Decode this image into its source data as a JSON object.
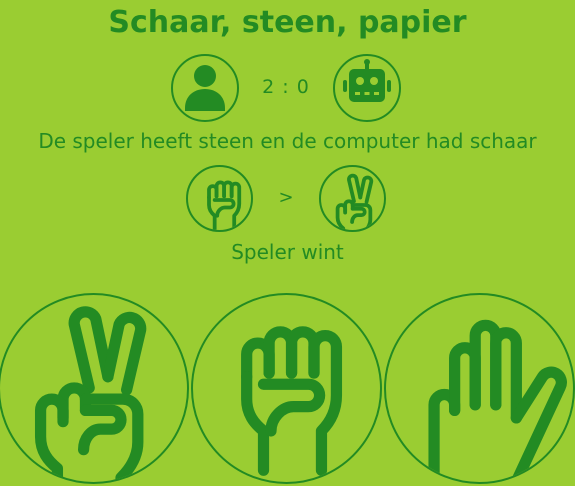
{
  "title": "Schaar, steen, papier",
  "score": {
    "player": 2,
    "computer": 0,
    "text": "2 : 0"
  },
  "message": "De speler heeft steen en de computer had schaar",
  "comparison": ">",
  "result": "Speler wint",
  "icons": {
    "player": "user-icon",
    "computer": "robot-icon",
    "player_hand": "fist-icon",
    "computer_hand": "victory-hand-icon"
  },
  "choices": [
    {
      "id": "schaar",
      "icon": "victory-hand-icon"
    },
    {
      "id": "steen",
      "icon": "fist-icon"
    },
    {
      "id": "papier",
      "icon": "open-hand-icon"
    }
  ],
  "colors": {
    "background": "#9ACD32",
    "foreground": "#238B23"
  }
}
